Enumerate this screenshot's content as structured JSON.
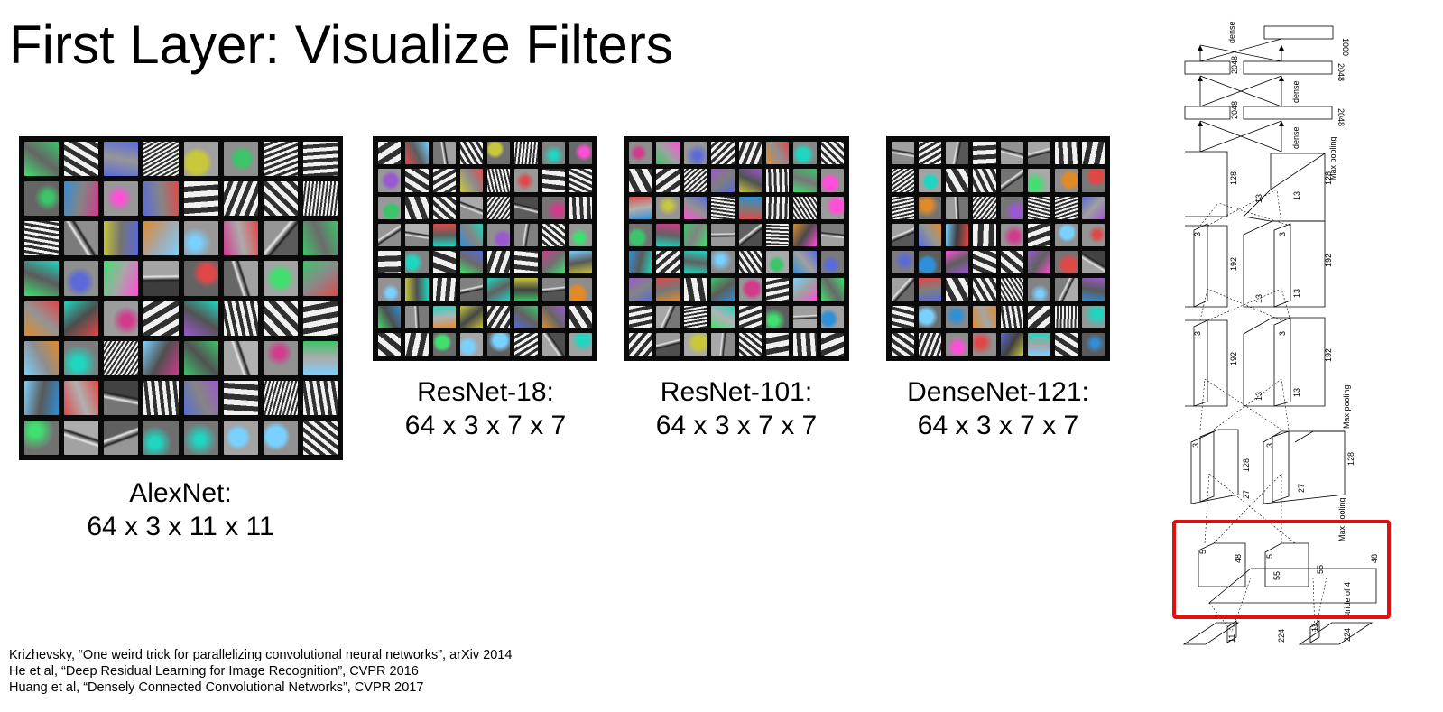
{
  "title": "First Layer: Visualize Filters",
  "panels": [
    {
      "id": "alexnet",
      "name": "AlexNet:",
      "shape": "64 x 3 x 11 x 11",
      "grid_size": 8
    },
    {
      "id": "resnet18",
      "name": "ResNet-18:",
      "shape": "64 x 3 x 7 x 7",
      "grid_size": 8
    },
    {
      "id": "resnet101",
      "name": "ResNet-101:",
      "shape": "64 x 3 x 7 x 7",
      "grid_size": 8
    },
    {
      "id": "densenet121",
      "name": "DenseNet-121:",
      "shape": "64 x 3 x 7 x 7",
      "grid_size": 8
    }
  ],
  "references": [
    "Krizhevsky, “One weird trick for parallelizing convolutional neural networks”, arXiv 2014",
    "He et al, “Deep Residual Learning for Image Recognition”, CVPR 2016",
    "Huang et al, “Densely Connected Convolutional Networks”, CVPR 2017"
  ],
  "architecture": {
    "labels": {
      "dense_top": "dense",
      "out_1000": "1000",
      "d2048_a": "2048",
      "d2048_b": "2048",
      "dense_mid": "dense",
      "d2048_c": "2048",
      "d2048_d": "2048",
      "dense_low": "dense",
      "max_pooling_1": "Max pooling",
      "c128_a": "128",
      "c128_b": "128",
      "c13_a": "13",
      "c13_b": "13",
      "c3_a": "3",
      "c3_b": "3",
      "c192_a": "192",
      "c192_b": "192",
      "c13_c": "13",
      "c13_d": "13",
      "c3_c": "3",
      "c3_d": "3",
      "c192_c": "192",
      "c192_d": "192",
      "c13_e": "13",
      "c13_f": "13",
      "max_pooling_2": "Max pooling",
      "c3_e": "3",
      "c3_f": "3",
      "c128_c": "128",
      "c128_d": "128",
      "c27_a": "27",
      "c27_b": "27",
      "max_pooling_3": "Max pooling",
      "c5_a": "5",
      "c5_b": "5",
      "c48_a": "48",
      "c48_b": "48",
      "c55_a": "55",
      "c55_b": "55",
      "stride": "Stride of 4",
      "c11_a": "11",
      "c11_b": "11",
      "c224_a": "224",
      "c224_b": "224"
    },
    "highlight_color": "#e01010"
  }
}
